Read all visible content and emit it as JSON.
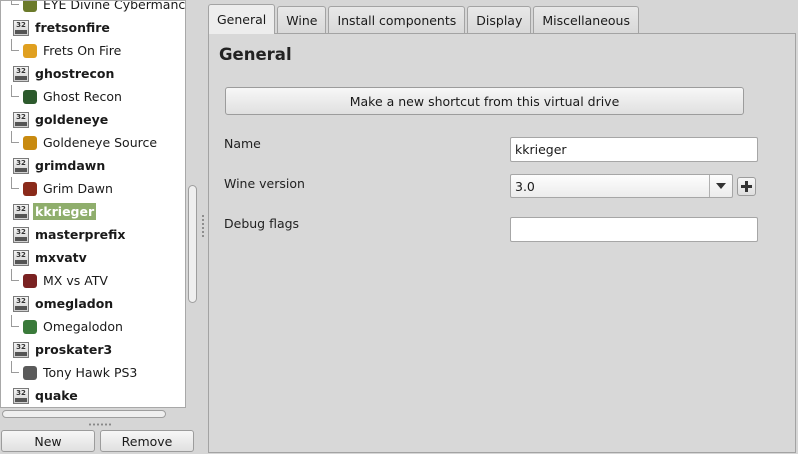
{
  "tree": {
    "rows": [
      {
        "kind": "child",
        "label": "EYE Divine Cybermancy",
        "icon": "eye-divine-cybermancy-icon",
        "color": "#6b7a2a",
        "last": true
      },
      {
        "kind": "prefix",
        "label": "fretsonfire",
        "badge": "32"
      },
      {
        "kind": "child",
        "label": "Frets On Fire",
        "icon": "frets-on-fire-icon",
        "color": "#e0a020",
        "last": true
      },
      {
        "kind": "prefix",
        "label": "ghostrecon",
        "badge": "32"
      },
      {
        "kind": "child",
        "label": "Ghost Recon",
        "icon": "ghost-recon-icon",
        "color": "#2d5a2d",
        "last": true
      },
      {
        "kind": "prefix",
        "label": "goldeneye",
        "badge": "32"
      },
      {
        "kind": "child",
        "label": "Goldeneye Source",
        "icon": "goldeneye-source-icon",
        "color": "#c88a10",
        "last": true
      },
      {
        "kind": "prefix",
        "label": "grimdawn",
        "badge": "32"
      },
      {
        "kind": "child",
        "label": "Grim Dawn",
        "icon": "grim-dawn-icon",
        "color": "#8a2a1a",
        "last": true
      },
      {
        "kind": "prefix",
        "label": "kkrieger",
        "badge": "32",
        "selected": true
      },
      {
        "kind": "prefix",
        "label": "masterprefix",
        "badge": "32"
      },
      {
        "kind": "prefix",
        "label": "mxvatv",
        "badge": "32"
      },
      {
        "kind": "child",
        "label": "MX vs ATV",
        "icon": "mx-vs-atv-icon",
        "color": "#7a2222",
        "last": true
      },
      {
        "kind": "prefix",
        "label": "omegladon",
        "badge": "32"
      },
      {
        "kind": "child",
        "label": "Omegalodon",
        "icon": "omegalodon-icon",
        "color": "#3a7a3a",
        "last": true
      },
      {
        "kind": "prefix",
        "label": "proskater3",
        "badge": "32"
      },
      {
        "kind": "child",
        "label": "Tony Hawk PS3",
        "icon": "tony-hawk-icon",
        "color": "#5a5a5a",
        "last": true
      },
      {
        "kind": "prefix",
        "label": "quake",
        "badge": "32"
      }
    ]
  },
  "buttons": {
    "new": "New",
    "remove": "Remove"
  },
  "tabs": [
    {
      "label": "General",
      "active": true
    },
    {
      "label": "Wine"
    },
    {
      "label": "Install components"
    },
    {
      "label": "Display"
    },
    {
      "label": "Miscellaneous"
    }
  ],
  "general": {
    "title": "General",
    "shortcut_button": "Make a new shortcut from this virtual drive",
    "name_label": "Name",
    "name_value": "kkrieger",
    "wine_version_label": "Wine version",
    "wine_version_value": "3.0",
    "debug_flags_label": "Debug flags",
    "debug_flags_value": ""
  },
  "colors": {
    "selection": "#8fae6c"
  }
}
